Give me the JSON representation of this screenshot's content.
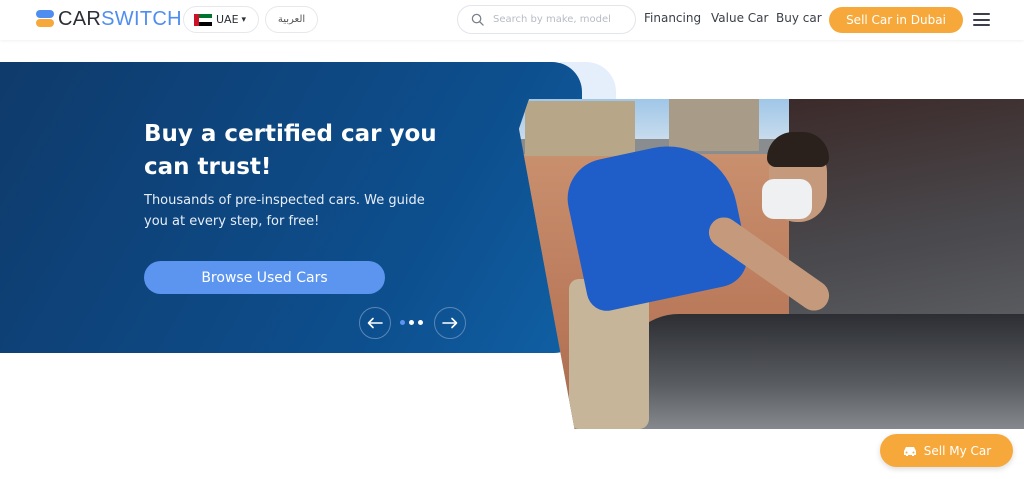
{
  "header": {
    "logo": {
      "part1": "CAR",
      "part2": "SWITCH"
    },
    "country": {
      "code": "UAE",
      "flag_icon": "uae-flag-icon"
    },
    "language_toggle": "العربية",
    "search": {
      "placeholder": "Search by make, model",
      "icon": "search-icon"
    },
    "nav": [
      {
        "label": "Financing"
      },
      {
        "label": "Value Car"
      },
      {
        "label": "Buy car"
      }
    ],
    "cta_label": "Sell Car in Dubai",
    "menu_icon": "hamburger-icon"
  },
  "hero": {
    "title": "Buy a certified car you can trust!",
    "subtitle": "Thousands of pre-inspected cars. We guide you at every step, for free!",
    "button_label": "Browse Used Cars",
    "carousel": {
      "slides": 3,
      "active_index": 0,
      "prev_icon": "arrow-left-icon",
      "next_icon": "arrow-right-icon"
    }
  },
  "floating_button": {
    "label": "Sell My Car",
    "icon": "car-icon"
  },
  "colors": {
    "brand_blue": "#4f8ef0",
    "brand_orange": "#f7a83a",
    "hero_navy": "#0f3a6b"
  }
}
